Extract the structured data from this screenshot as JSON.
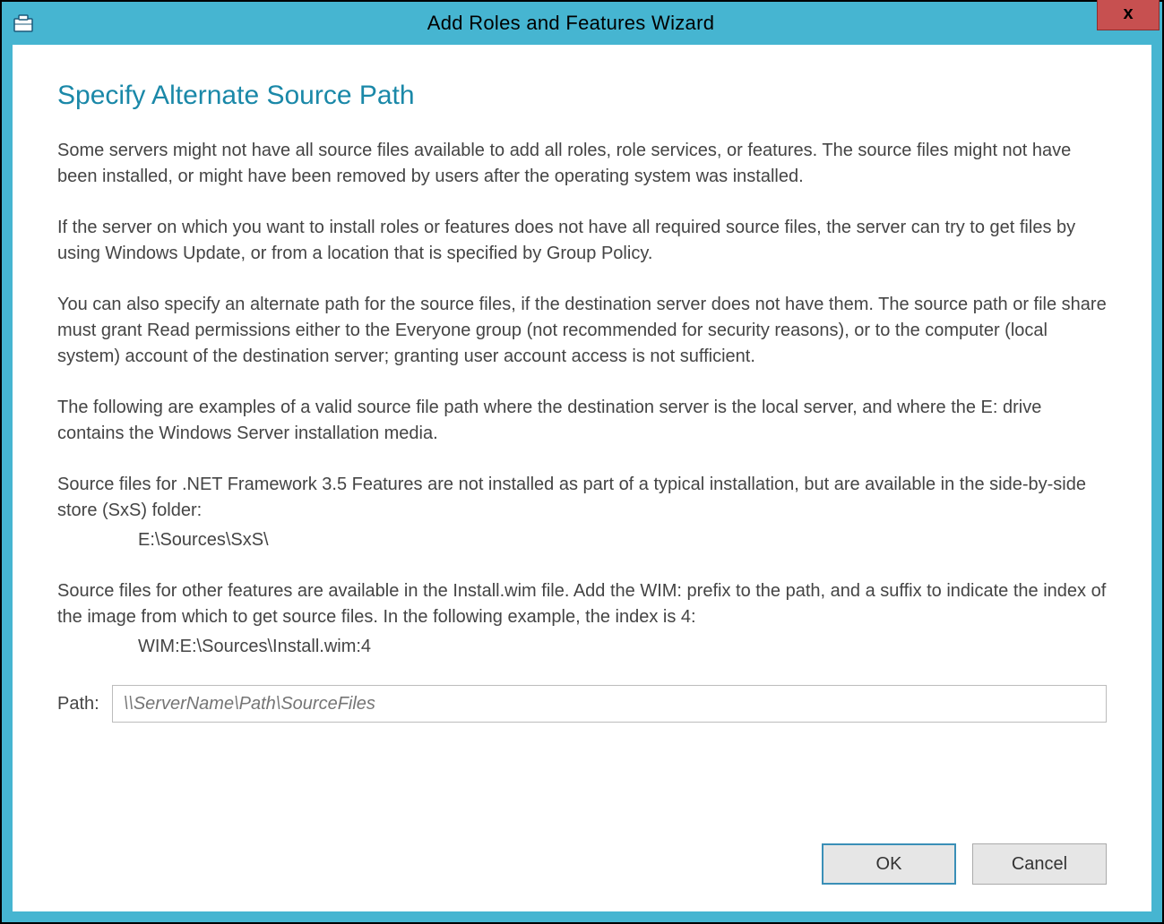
{
  "titlebar": {
    "title": "Add Roles and Features Wizard"
  },
  "dialog": {
    "heading": "Specify Alternate Source Path",
    "para1": "Some servers might not have all source files available to add all roles, role services, or features. The source files might not have been installed, or might have been removed by users after the operating system was installed.",
    "para2": "If the server on which you want to install roles or features does not have all required source files, the server can try to get files by using Windows Update, or from a location that is specified by Group Policy.",
    "para3": "You can also specify an alternate path for the source files, if the destination server does not have them. The source path or file share must grant Read permissions either to the Everyone group (not recommended for security reasons), or to the computer (local system) account of the destination server; granting user account access is not sufficient.",
    "para4": "The following are examples of a valid source file path where the destination server is the local server, and where the E: drive contains the Windows Server installation media.",
    "para5": "Source files for .NET Framework 3.5 Features are not installed as part of a typical installation, but are available in the side-by-side store (SxS) folder:",
    "example1": "E:\\Sources\\SxS\\",
    "para6": "Source files for other features are available in the Install.wim file. Add the WIM: prefix to the path, and a suffix to indicate the index of the image from which to get source files. In the following example, the index is 4:",
    "example2": "WIM:E:\\Sources\\Install.wim:4",
    "path_label": "Path:",
    "path_placeholder": "\\\\ServerName\\Path\\SourceFiles",
    "ok_label": "OK",
    "cancel_label": "Cancel"
  }
}
